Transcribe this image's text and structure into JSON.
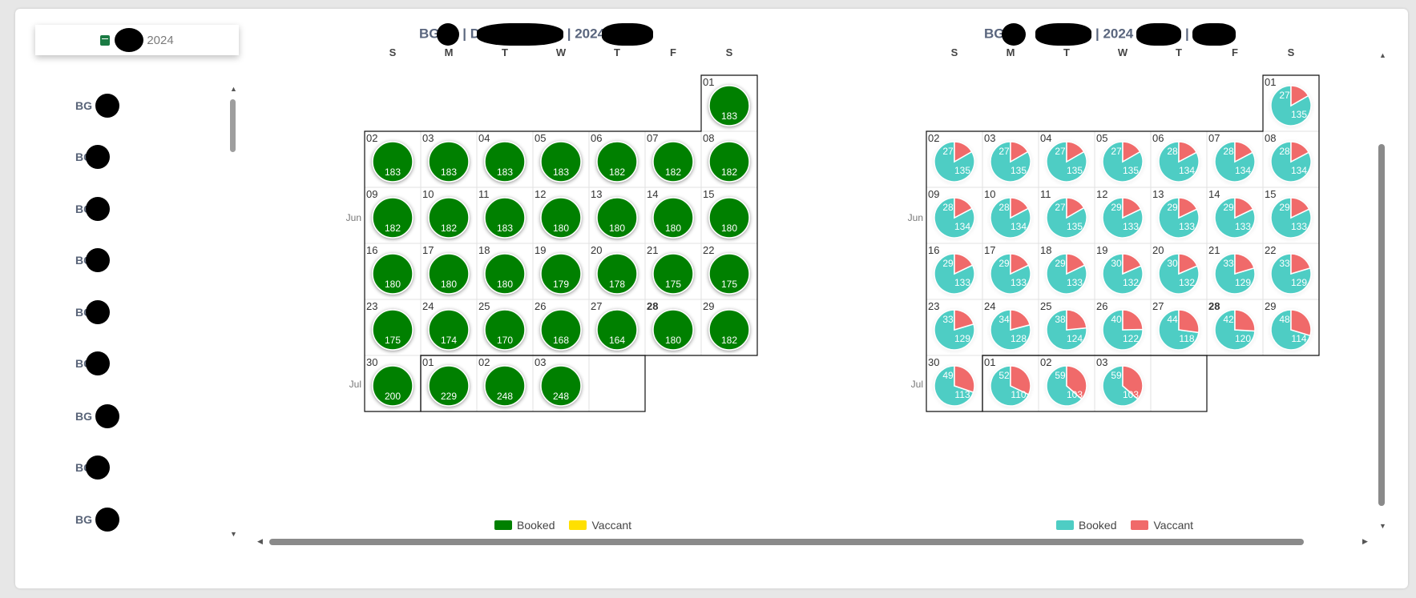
{
  "date_picker": {
    "label": "2024",
    "icon": "calendar-icon",
    "icon_color": "#1a7a43"
  },
  "sidebar": {
    "items": [
      {
        "label": "BG 1"
      },
      {
        "label": "BG"
      },
      {
        "label": "BG"
      },
      {
        "label": "BG"
      },
      {
        "label": "BG"
      },
      {
        "label": "BG"
      },
      {
        "label": "BG 1"
      },
      {
        "label": "BG"
      },
      {
        "label": "BG 1"
      }
    ]
  },
  "calendars": [
    {
      "title_parts": [
        "BG",
        "| D",
        "| 2024"
      ],
      "weekday_labels": [
        "S",
        "M",
        "T",
        "W",
        "T",
        "F",
        "S"
      ],
      "month_labels": [
        "Jun",
        "Jul"
      ],
      "chart_type": "solid",
      "colors": {
        "booked": "#008000",
        "vaccant": "#ffe000"
      },
      "legend": [
        {
          "label": "Booked",
          "color": "#008000"
        },
        {
          "label": "Vaccant",
          "color": "#ffe000"
        }
      ]
    },
    {
      "title_parts": [
        "BG",
        "",
        "| 2024",
        "|"
      ],
      "weekday_labels": [
        "S",
        "M",
        "T",
        "W",
        "T",
        "F",
        "S"
      ],
      "month_labels": [
        "Jun",
        "Jul"
      ],
      "chart_type": "pie",
      "colors": {
        "booked": "#4ecdc4",
        "vaccant": "#f06a6a"
      },
      "legend": [
        {
          "label": "Booked",
          "color": "#4ecdc4"
        },
        {
          "label": "Vaccant",
          "color": "#f06a6a"
        }
      ]
    }
  ],
  "chart_data": [
    {
      "type": "heatmap",
      "title": "",
      "days": [
        {
          "date": "06-01",
          "label": "01",
          "booked": 183,
          "vaccant": 0
        },
        {
          "date": "06-02",
          "label": "02",
          "booked": 183,
          "vaccant": 0
        },
        {
          "date": "06-03",
          "label": "03",
          "booked": 183,
          "vaccant": 0
        },
        {
          "date": "06-04",
          "label": "04",
          "booked": 183,
          "vaccant": 0
        },
        {
          "date": "06-05",
          "label": "05",
          "booked": 183,
          "vaccant": 0
        },
        {
          "date": "06-06",
          "label": "06",
          "booked": 182,
          "vaccant": 0
        },
        {
          "date": "06-07",
          "label": "07",
          "booked": 182,
          "vaccant": 0
        },
        {
          "date": "06-08",
          "label": "08",
          "booked": 182,
          "vaccant": 0
        },
        {
          "date": "06-09",
          "label": "09",
          "booked": 182,
          "vaccant": 0
        },
        {
          "date": "06-10",
          "label": "10",
          "booked": 182,
          "vaccant": 0
        },
        {
          "date": "06-11",
          "label": "11",
          "booked": 183,
          "vaccant": 0
        },
        {
          "date": "06-12",
          "label": "12",
          "booked": 180,
          "vaccant": 0
        },
        {
          "date": "06-13",
          "label": "13",
          "booked": 180,
          "vaccant": 0
        },
        {
          "date": "06-14",
          "label": "14",
          "booked": 180,
          "vaccant": 0
        },
        {
          "date": "06-15",
          "label": "15",
          "booked": 180,
          "vaccant": 0
        },
        {
          "date": "06-16",
          "label": "16",
          "booked": 180,
          "vaccant": 0
        },
        {
          "date": "06-17",
          "label": "17",
          "booked": 180,
          "vaccant": 0
        },
        {
          "date": "06-18",
          "label": "18",
          "booked": 180,
          "vaccant": 0
        },
        {
          "date": "06-19",
          "label": "19",
          "booked": 179,
          "vaccant": 0
        },
        {
          "date": "06-20",
          "label": "20",
          "booked": 178,
          "vaccant": 0
        },
        {
          "date": "06-21",
          "label": "21",
          "booked": 175,
          "vaccant": 0
        },
        {
          "date": "06-22",
          "label": "22",
          "booked": 175,
          "vaccant": 0
        },
        {
          "date": "06-23",
          "label": "23",
          "booked": 175,
          "vaccant": 0
        },
        {
          "date": "06-24",
          "label": "24",
          "booked": 174,
          "vaccant": 0
        },
        {
          "date": "06-25",
          "label": "25",
          "booked": 170,
          "vaccant": 0
        },
        {
          "date": "06-26",
          "label": "26",
          "booked": 168,
          "vaccant": 0
        },
        {
          "date": "06-27",
          "label": "27",
          "booked": 164,
          "vaccant": 0
        },
        {
          "date": "06-28",
          "label": "28",
          "booked": 180,
          "vaccant": 0,
          "highlight": true
        },
        {
          "date": "06-29",
          "label": "29",
          "booked": 182,
          "vaccant": 0
        },
        {
          "date": "06-30",
          "label": "30",
          "booked": 200,
          "vaccant": 0
        },
        {
          "date": "07-01",
          "label": "01",
          "booked": 229,
          "vaccant": 0
        },
        {
          "date": "07-02",
          "label": "02",
          "booked": 248,
          "vaccant": 0
        },
        {
          "date": "07-03",
          "label": "03",
          "booked": 248,
          "vaccant": 0
        }
      ]
    },
    {
      "type": "pie",
      "title": "",
      "days": [
        {
          "date": "06-01",
          "label": "01",
          "booked": 135,
          "vaccant": 27
        },
        {
          "date": "06-02",
          "label": "02",
          "booked": 135,
          "vaccant": 27
        },
        {
          "date": "06-03",
          "label": "03",
          "booked": 135,
          "vaccant": 27
        },
        {
          "date": "06-04",
          "label": "04",
          "booked": 135,
          "vaccant": 27
        },
        {
          "date": "06-05",
          "label": "05",
          "booked": 135,
          "vaccant": 27
        },
        {
          "date": "06-06",
          "label": "06",
          "booked": 134,
          "vaccant": 28
        },
        {
          "date": "06-07",
          "label": "07",
          "booked": 134,
          "vaccant": 28
        },
        {
          "date": "06-08",
          "label": "08",
          "booked": 134,
          "vaccant": 28
        },
        {
          "date": "06-09",
          "label": "09",
          "booked": 134,
          "vaccant": 28
        },
        {
          "date": "06-10",
          "label": "10",
          "booked": 134,
          "vaccant": 28
        },
        {
          "date": "06-11",
          "label": "11",
          "booked": 135,
          "vaccant": 27
        },
        {
          "date": "06-12",
          "label": "12",
          "booked": 133,
          "vaccant": 29
        },
        {
          "date": "06-13",
          "label": "13",
          "booked": 133,
          "vaccant": 29
        },
        {
          "date": "06-14",
          "label": "14",
          "booked": 133,
          "vaccant": 29
        },
        {
          "date": "06-15",
          "label": "15",
          "booked": 133,
          "vaccant": 29
        },
        {
          "date": "06-16",
          "label": "16",
          "booked": 133,
          "vaccant": 29
        },
        {
          "date": "06-17",
          "label": "17",
          "booked": 133,
          "vaccant": 29
        },
        {
          "date": "06-18",
          "label": "18",
          "booked": 133,
          "vaccant": 29
        },
        {
          "date": "06-19",
          "label": "19",
          "booked": 132,
          "vaccant": 30
        },
        {
          "date": "06-20",
          "label": "20",
          "booked": 132,
          "vaccant": 30
        },
        {
          "date": "06-21",
          "label": "21",
          "booked": 129,
          "vaccant": 33
        },
        {
          "date": "06-22",
          "label": "22",
          "booked": 129,
          "vaccant": 33
        },
        {
          "date": "06-23",
          "label": "23",
          "booked": 129,
          "vaccant": 33
        },
        {
          "date": "06-24",
          "label": "24",
          "booked": 128,
          "vaccant": 34
        },
        {
          "date": "06-25",
          "label": "25",
          "booked": 124,
          "vaccant": 38
        },
        {
          "date": "06-26",
          "label": "26",
          "booked": 122,
          "vaccant": 40
        },
        {
          "date": "06-27",
          "label": "27",
          "booked": 118,
          "vaccant": 44
        },
        {
          "date": "06-28",
          "label": "28",
          "booked": 120,
          "vaccant": 42,
          "highlight": true
        },
        {
          "date": "06-29",
          "label": "29",
          "booked": 114,
          "vaccant": 48
        },
        {
          "date": "06-30",
          "label": "30",
          "booked": 113,
          "vaccant": 49
        },
        {
          "date": "07-01",
          "label": "01",
          "booked": 110,
          "vaccant": 52
        },
        {
          "date": "07-02",
          "label": "02",
          "booked": 103,
          "vaccant": 59
        },
        {
          "date": "07-03",
          "label": "03",
          "booked": 103,
          "vaccant": 59
        }
      ]
    }
  ]
}
